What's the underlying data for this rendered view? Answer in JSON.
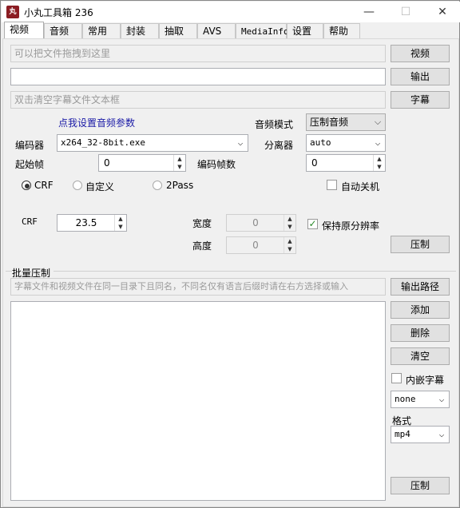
{
  "window": {
    "icon_text": "丸",
    "title": "小丸工具箱 236",
    "minimize_glyph": "—",
    "maximize_glyph": "☐",
    "close_glyph": "✕"
  },
  "tabs": [
    "视频",
    "音频",
    "常用",
    "封装",
    "抽取",
    "AVS",
    "MediaInfo",
    "设置",
    "帮助"
  ],
  "top": {
    "video_drop_placeholder": "可以把文件拖拽到这里",
    "output_value": "",
    "subtitle_placeholder": "双击清空字幕文件文本框",
    "video_button": "视频",
    "output_button": "输出",
    "subtitle_button": "字幕"
  },
  "audio": {
    "settings_link": "点我设置音频参数",
    "mode_label": "音频模式",
    "mode_value": "压制音频"
  },
  "encoder": {
    "label": "编码器",
    "value": "x264_32-8bit.exe",
    "demuxer_label": "分离器",
    "demuxer_value": "auto"
  },
  "frames": {
    "start_label": "起始帧",
    "start_value": "0",
    "count_label": "编码帧数",
    "count_value": "0"
  },
  "rate_mode": {
    "crf_label": "CRF",
    "custom_label": "自定义",
    "twopass_label": "2Pass",
    "selected": "CRF",
    "auto_shutdown_label": "自动关机"
  },
  "quality": {
    "crf_label": "CRF",
    "crf_value": "23.5",
    "width_label": "宽度",
    "width_value": "0",
    "height_label": "高度",
    "height_value": "0",
    "keep_res_label": "保持原分辨率",
    "keep_res_checked": true,
    "compress_button": "压制"
  },
  "batch": {
    "section_label": "批量压制",
    "hint": "字幕文件和视频文件在同一目录下且同名，不同名仅有语言后缀时请在右方选择或输入",
    "output_path_button": "输出路径",
    "add_button": "添加",
    "delete_button": "删除",
    "clear_button": "清空",
    "embed_sub_label": "内嵌字幕",
    "embed_sub_value": "none",
    "format_label": "格式",
    "format_value": "mp4",
    "compress_button": "压制"
  }
}
